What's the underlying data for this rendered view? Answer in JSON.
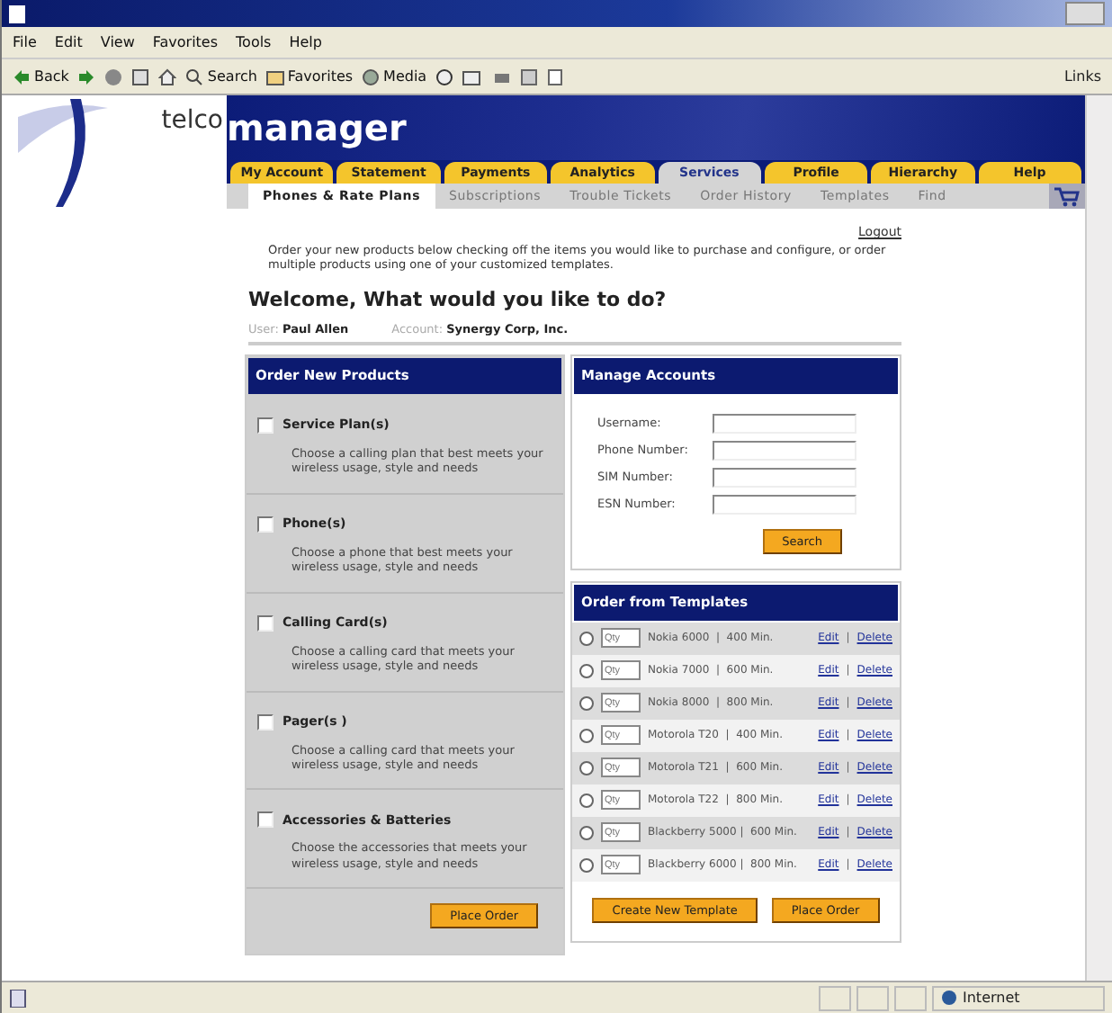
{
  "browser": {
    "menu": [
      "File",
      "Edit",
      "View",
      "Favorites",
      "Tools",
      "Help"
    ],
    "toolbar": [
      {
        "kind": "back",
        "label": "Back"
      },
      {
        "kind": "forward"
      },
      {
        "kind": "stop"
      },
      {
        "kind": "refresh"
      },
      {
        "kind": "home"
      },
      {
        "kind": "search",
        "label": "Search"
      },
      {
        "kind": "favorites",
        "label": "Favorites"
      },
      {
        "kind": "media",
        "label": "Media"
      },
      {
        "kind": "history"
      },
      {
        "kind": "mail"
      },
      {
        "kind": "print"
      },
      {
        "kind": "edit"
      },
      {
        "kind": "discuss"
      }
    ],
    "links": "Links",
    "status": "Internet"
  },
  "header": {
    "logo_prefix": "telco",
    "logo_main": "manager"
  },
  "tabs": [
    {
      "label": "My Account",
      "selected": false
    },
    {
      "label": "Statement",
      "selected": false
    },
    {
      "label": "Payments",
      "selected": false
    },
    {
      "label": "Analytics",
      "selected": false
    },
    {
      "label": "Services",
      "selected": true
    },
    {
      "label": "Profile",
      "selected": false
    },
    {
      "label": "Hierarchy",
      "selected": false
    },
    {
      "label": "Help",
      "selected": false
    }
  ],
  "subtabs": [
    {
      "label": "Phones & Rate Plans",
      "selected": true
    },
    {
      "label": "Subscriptions",
      "selected": false
    },
    {
      "label": "Trouble Tickets",
      "selected": false
    },
    {
      "label": "Order History",
      "selected": false
    },
    {
      "label": "Templates",
      "selected": false
    },
    {
      "label": "Find",
      "selected": false
    }
  ],
  "logout": "Logout",
  "intro": "Order your new products below checking off the items you would like to purchase and configure, or order multiple products using one of your customized templates.",
  "welcome": "Welcome, What would you like to do?",
  "user": {
    "label": "User:",
    "value": "Paul Allen"
  },
  "account": {
    "label": "Account:",
    "value": "Synergy Corp, Inc."
  },
  "products": {
    "title": "Order New Products",
    "items": [
      {
        "name": "Service Plan(s)",
        "description": "Choose a calling plan that best meets your wireless usage, style and needs",
        "checked": false
      },
      {
        "name": "Phone(s)",
        "description": "Choose a phone that best meets your wireless usage, style and needs",
        "checked": false
      },
      {
        "name": "Calling Card(s)",
        "description": "Choose a calling card that meets your wireless usage, style and needs",
        "checked": false
      },
      {
        "name": "Pager(s )",
        "description": "Choose a calling card that meets your wireless usage, style and needs",
        "checked": false
      },
      {
        "name": "Accessories & Batteries",
        "description": "Choose the accessories that meets your wireless usage, style and needs",
        "checked": false
      }
    ],
    "button": "Place Order"
  },
  "manage": {
    "title": "Manage Accounts",
    "fields": [
      {
        "label": "Username:"
      },
      {
        "label": "Phone Number:"
      },
      {
        "label": "SIM Number:"
      },
      {
        "label": "ESN Number:"
      }
    ],
    "button": "Search"
  },
  "templates": {
    "title": "Order from Templates",
    "rows": [
      {
        "name": "Nokia 6000  |  400 Min.",
        "selected": false,
        "placeholder": "Qty",
        "edit": "Edit",
        "separator": "|",
        "delete": "Delete"
      },
      {
        "name": "Nokia 7000  |  600 Min.",
        "selected": false,
        "placeholder": "Qty",
        "edit": "Edit",
        "separator": "|",
        "delete": "Delete"
      },
      {
        "name": "Nokia 8000  |  800 Min.",
        "selected": false,
        "placeholder": "Qty",
        "edit": "Edit",
        "separator": "|",
        "delete": "Delete"
      },
      {
        "name": "Motorola T20  |  400 Min.",
        "selected": false,
        "placeholder": "Qty",
        "edit": "Edit",
        "separator": "|",
        "delete": "Delete"
      },
      {
        "name": "Motorola T21  |  600 Min.",
        "selected": false,
        "placeholder": "Qty",
        "edit": "Edit",
        "separator": "|",
        "delete": "Delete"
      },
      {
        "name": "Motorola T22  |  800 Min.",
        "selected": false,
        "placeholder": "Qty",
        "edit": "Edit",
        "separator": "|",
        "delete": "Delete"
      },
      {
        "name": "Blackberry 5000 |  600 Min.",
        "selected": false,
        "placeholder": "Qty",
        "edit": "Edit",
        "separator": "|",
        "delete": "Delete"
      },
      {
        "name": "Blackberry 6000 |  800 Min.",
        "selected": false,
        "placeholder": "Qty",
        "edit": "Edit",
        "separator": "|",
        "delete": "Delete"
      }
    ],
    "buttons": [
      "Create New Template",
      "Place Order"
    ]
  }
}
